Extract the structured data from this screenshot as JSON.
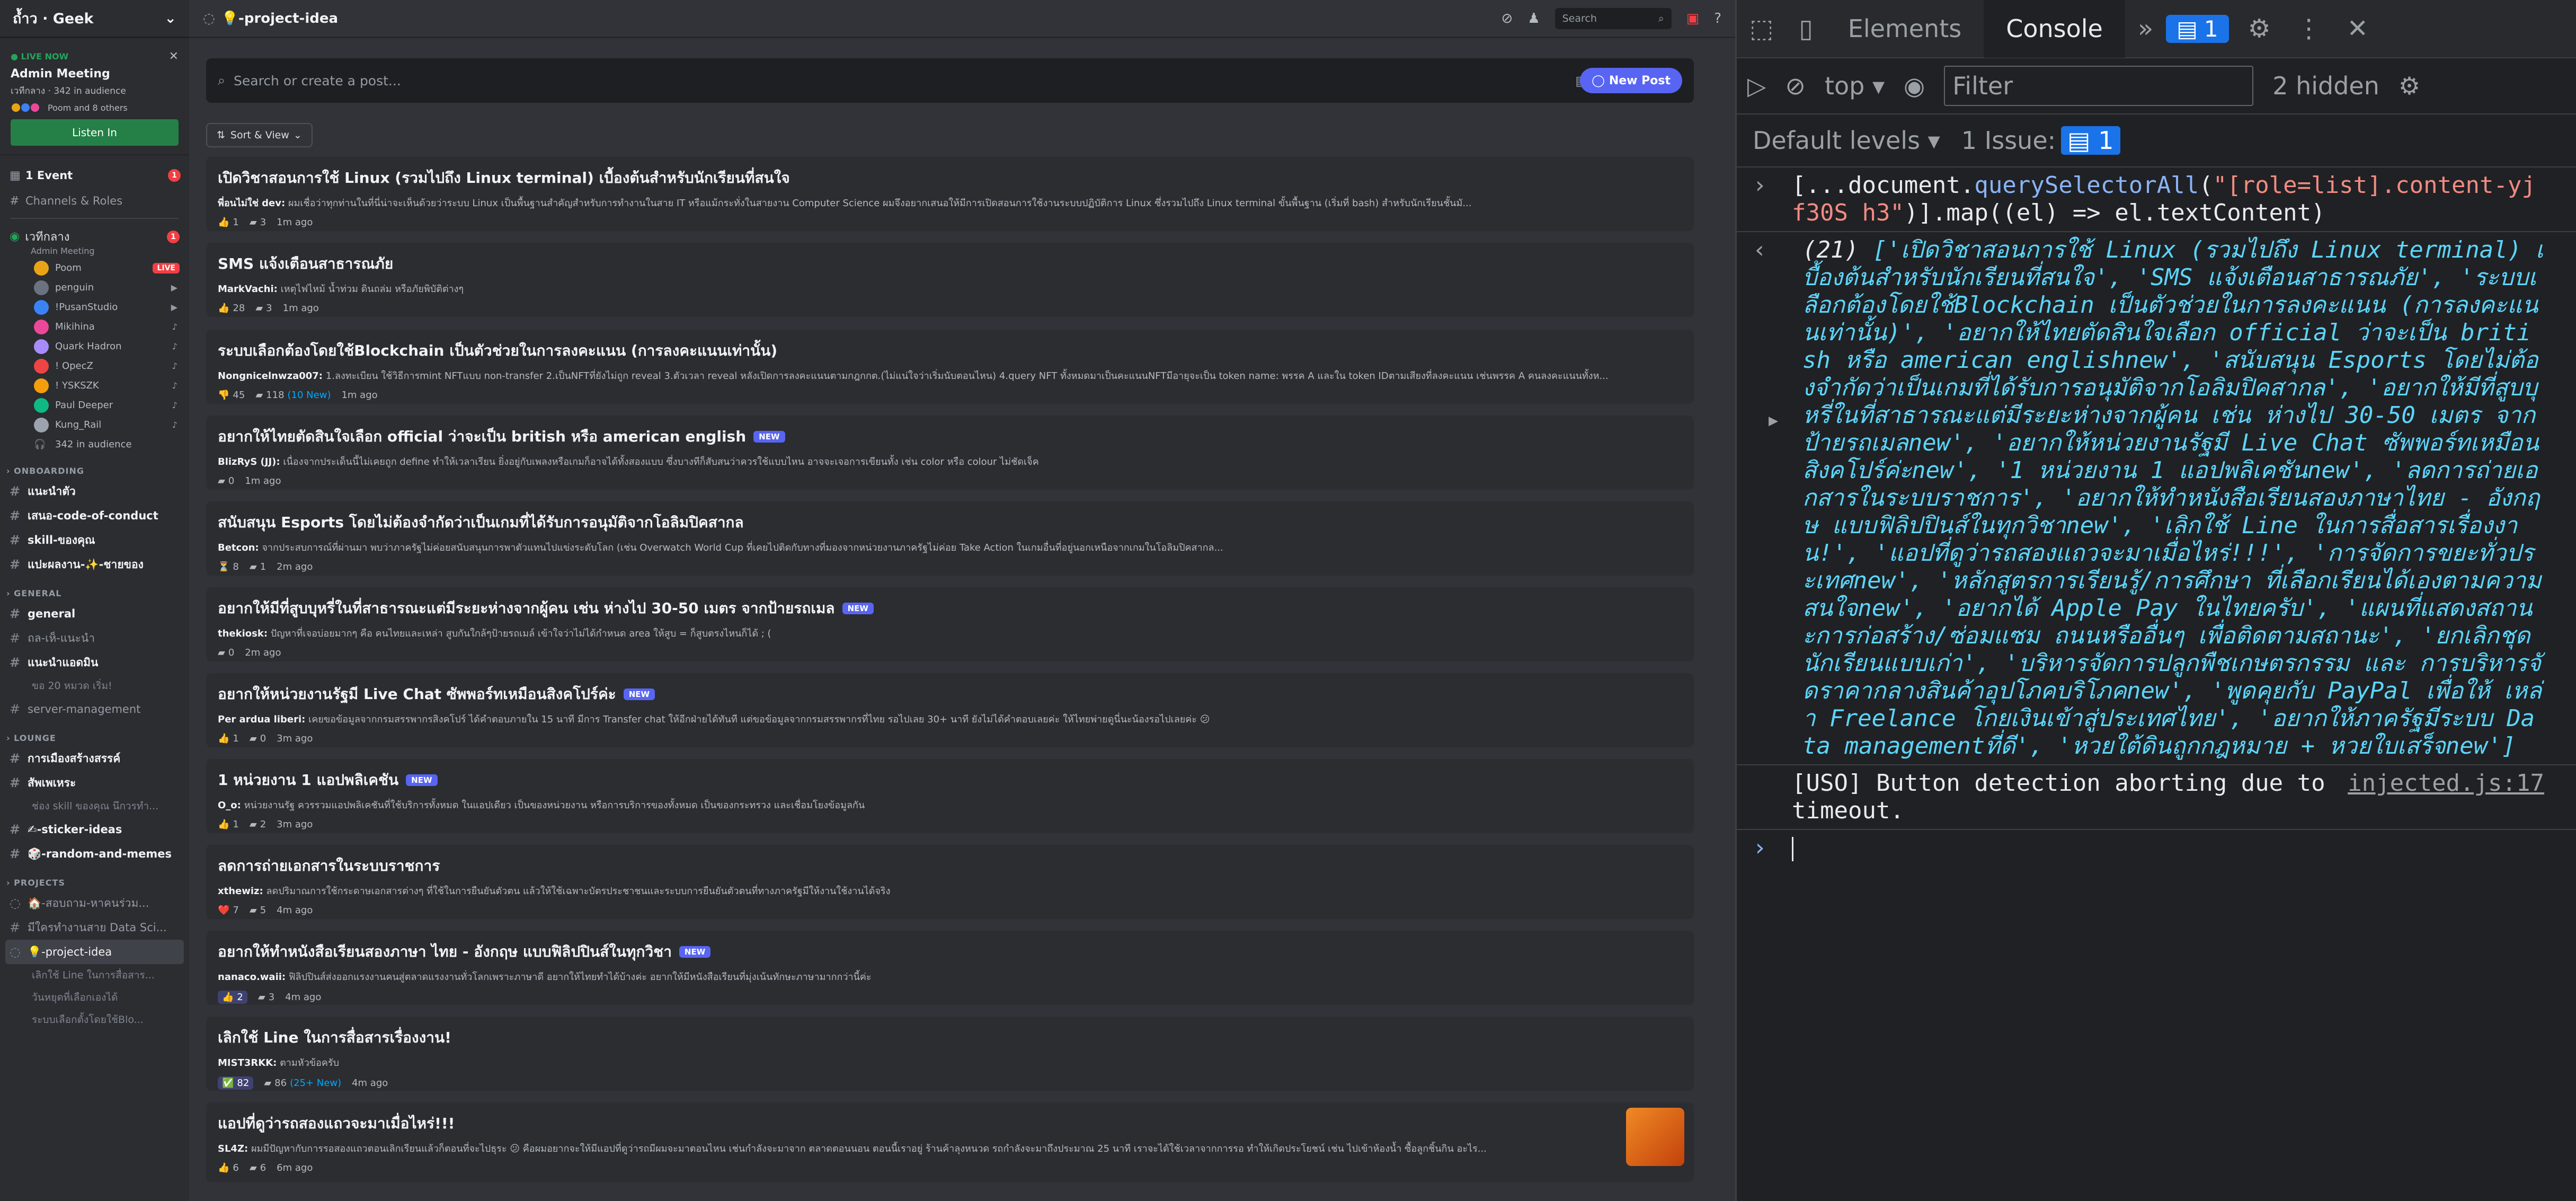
{
  "guild": {
    "name": "ถ้ำว · Geek"
  },
  "live": {
    "label": "LIVE NOW",
    "title": "Admin Meeting",
    "sub": "เวทีกลาง · 342 in audience",
    "users": "Poom and 8 others",
    "listen": "Listen In"
  },
  "nav": [
    {
      "label": "1 Event",
      "badge": "1"
    },
    {
      "label": "Channels & Roles"
    }
  ],
  "voice": {
    "name": "เวทีกลาง",
    "sub": "Admin Meeting",
    "badge": "1",
    "users": [
      {
        "name": "Poom",
        "color": "#e8a317",
        "live": "LIVE"
      },
      {
        "name": "penguin",
        "color": "#6b7280"
      },
      {
        "name": "!PusanStudio",
        "color": "#3b82f6"
      },
      {
        "name": "Mikihina",
        "color": "#ec4899"
      },
      {
        "name": "Quark Hadron",
        "color": "#a78bfa"
      },
      {
        "name": "! OpecZ",
        "color": "#ef4444"
      },
      {
        "name": "! YSKSZK",
        "color": "#f59e0b"
      },
      {
        "name": "Paul Deeper",
        "color": "#10b981"
      },
      {
        "name": "Kung_Rail",
        "color": "#9ca3af"
      }
    ],
    "audience": "342 in audience"
  },
  "categories": {
    "onboarding": "ONBOARDING",
    "general": "GENERAL",
    "lounge": "LOUNGE",
    "projects": "PROJECTS"
  },
  "channels": {
    "onboarding": [
      "แนะนำตัว",
      "เสนอ-code-of-conduct",
      "skill-ของคุณ",
      "แปะผลงาน-✨-ชายของ"
    ],
    "general": [
      "general",
      "ถล-เห็-แนะนำ",
      "แนะนำแอดมิน",
      "ขอ 20 หมวด เริ่ม!",
      "server-management"
    ],
    "lounge": [
      "การเมืองสร้างสรรค์",
      "สัพเพเหระ",
      "ช่อง skill ของคุณ นึกวรทำ...",
      "✍-sticker-ideas",
      "🎲-random-and-memes"
    ],
    "projects": [
      "🏠-สอบถาม-หาคนร่วม...",
      "มีใครทำงานสาย Data Sci...",
      "💡-project-idea",
      "เลิกใช้ Line ในการสื่อสาร...",
      "วันหยุดที่เลือกเองได้",
      "ระบบเลือกตั้งโดยใช้Blo..."
    ]
  },
  "forum": {
    "channel": "💡-project-idea",
    "search_placeholder": "Search",
    "post_placeholder": "Search or create a post...",
    "new_post": "New Post",
    "sort": "Sort & View"
  },
  "posts": [
    {
      "title": "เปิดวิชาสอนการใช้ Linux (รวมไปถึง Linux terminal) เบื้องต้นสำหรับนักเรียนที่สนใจ",
      "author": "พี่อนไม่ใช่ dev:",
      "snippet": "ผมเชื่อว่าทุกท่านในที่นี่น่าจะเห็นด้วยว่าระบบ Linux เป็นพื้นฐานสำคัญสำหรับการทำงานในสาย IT หรือแม้กระทั่งในสายงาน Computer Science ผมจึงอยากเสนอให้มีการเปิดสอนการใช้งานระบบปฏิบัติการ Linux ซึ่งรวมไปถึง Linux terminal ขั้นพื้นฐาน (เริ่มที่ bash) สำหรับนักเรียนชั้นมั...",
      "r_icon": "👍",
      "r_count": "1",
      "comments": "3",
      "new_c": "",
      "time": "1m ago",
      "is_new": false
    },
    {
      "title": "SMS แจ้งเตือนสาธารณภัย",
      "author": "MarkVachi:",
      "snippet": "เหตุไฟไหม้ น้ำท่วม ดินถล่ม หรือภัยพิบัติต่างๆ",
      "r_icon": "👍",
      "r_count": "28",
      "comments": "3",
      "new_c": "",
      "time": "1m ago",
      "is_new": false
    },
    {
      "title": "ระบบเลือกต้องโดยใช้Blockchain เป็นตัวช่วยในการลงคะแนน (การลงคะแนนเท่านั้น)",
      "author": "Nongnicelnwza007:",
      "snippet": "1.ลงทะเบียน ใช้วิธีการmint NFTแบบ non-transfer 2.เป็นNFTที่ยังไม่ถูก reveal 3.ตัวเวลา reveal หลังเปิดการลงคะแนนตามกฎกกต.(ไม่แน่ใจว่าเริ่มนับตอนไหน) 4.query NFT ทั้งหมดมาเป็นคะแนนNFTมีอายุจะเป็น token name: พรรค A และใน token IDตามเสียงที่ลงคะแนน เช่นพรรค A คนลงคะแนนทั้งห...",
      "r_icon": "👎",
      "r_count": "45",
      "comments": "118",
      "new_c": "(10 New)",
      "time": "1m ago",
      "is_new": false
    },
    {
      "title": "อยากให้ไทยตัดสินใจเลือก official ว่าจะเป็น british หรือ american english",
      "author": "BlizRyS (JJ):",
      "snippet": "เนื่องจากประเด็นนี้ไม่เคยถูก define ทำให้เวลาเรียน ยิ่งอยู่กับเพลงหรือเกมก็อาจได้ทั้งสองแบบ ซึ่งบางทีก็สับสนว่าควรใช้แบบไหน อาจจะเจอการเขียนทั้ง เช่น color หรือ colour ไม่ชัดเจ็ค",
      "r_icon": "",
      "r_count": "",
      "comments": "0",
      "new_c": "",
      "time": "1m ago",
      "is_new": true
    },
    {
      "title": "สนับสนุน Esports โดยไม่ต้องจำกัดว่าเป็นเกมที่ได้รับการอนุมัติจากโอลิมปิคสากล",
      "author": "Betcon:",
      "snippet": "จากประสบการณ์ที่ผ่านมา พบว่าภาครัฐไม่ค่อยสนับสนุนการพาตัวแทนไปแข่งระดับโลก (เช่น Overwatch World Cup ที่เคยไปติดกับทางที่มองจากหน่วยงานภาครัฐไม่ค่อย Take Action ในเกมอื่นที่อยู่นอกเหนือจากเกมในโอลิมปิคสากล...",
      "r_icon": "⏳",
      "r_count": "8",
      "comments": "1",
      "new_c": "",
      "time": "2m ago",
      "is_new": false
    },
    {
      "title": "อยากให้มีที่สูบบุหรี่ในที่สาธารณะแต่มีระยะห่างจากผู้คน เช่น ห่างไป 30-50 เมตร จากป้ายรถเมล",
      "author": "thekiosk:",
      "snippet": "ปัญหาที่เจอบ่อยมากๆ คือ คนไทยและเหล่า สูบกันใกล้ๆป้ายรถเมล์ เข้าใจว่าไม่ได้กำหนด area ให้สูบ = ก็สูบตรงไหนก็ได้ ; (",
      "r_icon": "",
      "r_count": "",
      "comments": "0",
      "new_c": "",
      "time": "2m ago",
      "is_new": true
    },
    {
      "title": "อยากให้หน่วยงานรัฐมี Live Chat ซัพพอร์ทเหมือนสิงคโปร์ค่ะ",
      "author": "Per ardua liberi:",
      "snippet": "เคยขอข้อมูลจากกรมสรรพากรสิงคโปร์ ได้คำตอบภายใน 15 นาที มีการ Transfer chat ให้อีกฝ่ายได้ทันที แต่ขอข้อมูลจากกรมสรรพากรที่ไทย รอไปเลย 30+ นาที ยังไม่ได้คำตอบเลยค่ะ ให้ไทยพ่ายดูนี่นะน้องรอไปเลยค่ะ 😕",
      "r_icon": "👍",
      "r_count": "1",
      "comments": "0",
      "new_c": "",
      "time": "3m ago",
      "is_new": true
    },
    {
      "title": "1 หน่วยงาน 1 แอปพลิเคชัน",
      "author": "O_o:",
      "snippet": "หน่วยงานรัฐ ควรรวมแอปพลิเคชันที่ใช้บริการทั้งหมด ในแอปเดียว เป็นของหน่วยงาน หรือการบริการของทั้งหมด เป็นของกระทรวง และเชื่อมโยงข้อมูลกัน",
      "r_icon": "👍",
      "r_count": "1",
      "comments": "2",
      "new_c": "",
      "time": "3m ago",
      "is_new": true
    },
    {
      "title": "ลดการถ่ายเอกสารในระบบราชการ",
      "author": "xthewiz:",
      "snippet": "ลดปริมาณการใช้กระดาษเอกสารต่างๆ ที่ใช้ในการยืนยันตัวตน แล้วให้ใช้เฉพาะบัตรประชาชนและระบบการยืนยันตัวตนที่ทางภาครัฐมีให้งานใช้งานได้จริง",
      "r_icon": "❤️",
      "r_count": "7",
      "comments": "5",
      "new_c": "",
      "time": "4m ago",
      "is_new": false
    },
    {
      "title": "อยากให้ทำหนังสือเรียนสองภาษา ไทย - อังกฤษ แบบฟิลิปปินส์ในทุกวิชา",
      "author": "nanaco.waii:",
      "snippet": "ฟิลิปปินส์ส่งออกแรงงานคนสู่ตลาดแรงงานทั่วโลกเพราะภาษาดี อยากให้ไทยทำได้บ้างค่ะ อยากให้มีหนังสือเรียนที่มุ่งเน้นทักษะภาษามากกว่านี้ค่ะ",
      "r_icon": "👍",
      "r_count": "2",
      "comments": "3",
      "new_c": "",
      "time": "4m ago",
      "is_new": true
    },
    {
      "title": "เลิกใช้ Line ในการสื่อสารเรื่องงาน!",
      "author": "MIST3RKK:",
      "snippet": "ตามหัวข้อครับ",
      "r_icon": "✅",
      "r_count": "82",
      "comments": "86",
      "new_c": "(25+ New)",
      "time": "4m ago",
      "is_new": false
    },
    {
      "title": "แอปที่ดูว่ารถสองแถวจะมาเมื่อไหร่!!!",
      "author": "SL4Z:",
      "snippet": "ผมมีปัญหากับการรอสองแถวตอนเลิกเรียนแล้วก็ตอนที่จะไปธุระ 😕 คือผมอยากจะให้มีแอปที่ดูว่ารถมีผมจะมาตอนไหน เช่นกำลังจะมาจาก ตลาดตอนนอน ตอนนี้เราอยู่ ร้านค้าลุงหนวด รถกำลังจะมาถึงประมาณ 25 นาที เราจะได้ใช้เวลาจากการรอ ทำให้เกิดประโยชน์ เช่น ไปเข้าห้องน้ำ ซื้อลูกชิ้นกิน อะไร...",
      "r_icon": "👍",
      "r_count": "6",
      "comments": "6",
      "new_c": "",
      "time": "6m ago",
      "is_new": false
    }
  ],
  "devtools": {
    "tabs": [
      "Elements",
      "Console"
    ],
    "issues_count": "1",
    "context": "top",
    "filter_placeholder": "Filter",
    "hidden": "2 hidden",
    "levels": "Default levels",
    "issue_label": "1 Issue:",
    "issue_count": "1",
    "cmd_pre": "[...document.",
    "cmd_fn": "querySelectorAll",
    "cmd_str": "\"[role=list].content-yjf30S h3\"",
    "cmd_post": ")].map((el) => el.textContent)",
    "result_count": "(21)",
    "result_text": "['เปิดวิชาสอนการใช้ Linux (รวมไปถึง Linux terminal) เบื้องต้นสำหรับนักเรียนที่สนใจ', 'SMS แจ้งเตือนสาธารณภัย', 'ระบบเลือกต้องโดยใช้Blockchain เป็นตัวช่วยในการลงคะแนน (การลงคะแนนเท่านั้น)', 'อยากให้ไทยตัดสินใจเลือก official ว่าจะเป็น british หรือ american englishnew', 'สนับสนุน Esports โดยไม่ต้องจำกัดว่าเป็นเกมที่ได้รับการอนุมัติจากโอลิมปิคสากล', 'อยากให้มีที่สูบบุหรี่ในที่สาธารณะแต่มีระยะห่างจากผู้คน เช่น ห่างไป 30-50 เมตร จากป้ายรถเมลnew', 'อยากให้หน่วยงานรัฐมี Live Chat ซัพพอร์ทเหมือนสิงคโปร์ค่ะnew', '1 หน่วยงาน 1 แอปพลิเคชันnew', 'ลดการถ่ายเอกสารในระบบราชการ', 'อยากให้ทำหนังสือเรียนสองภาษาไทย - อังกฤษ แบบฟิลิปปินส์ในทุกวิชาnew', 'เลิกใช้ Line ในการสื่อสารเรื่องงาน!', 'แอปที่ดูว่ารถสองแถวจะมาเมื่อไหร่!!!', 'การจัดการขยะทั่วประเทศnew', 'หลักสูตรการเรียนรู้/การศึกษา ที่เลือกเรียนได้เองตามความสนใจnew', 'อยากได้ Apple Pay ในไทยครับ', 'แผนที่แสดงสถานะการก่อสร้าง/ซ่อมแซม ถนนหรืออื่นๆ เพื่อติดตามสถานะ', 'ยกเลิกชุดนักเรียนแบบเก่า', 'บริหารจัดการปลูกพืชเกษตรกรรม และ การบริหารจัดราคากลางสินค้าอุปโภคบริโภคnew', 'พูดคุยกับ PayPal เพื่อให้ เหล่า Freelance โกยเงินเข้าสู่ประเทศไทย', 'อยากให้ภาครัฐมีระบบ Data managementที่ดี', 'หวยใต้ดินถูกกฎหมาย + หวยใบเสร็จnew']",
    "msg": "[USO] Button detection aborting due to timeout.",
    "msg_link": "injected.js:17"
  }
}
